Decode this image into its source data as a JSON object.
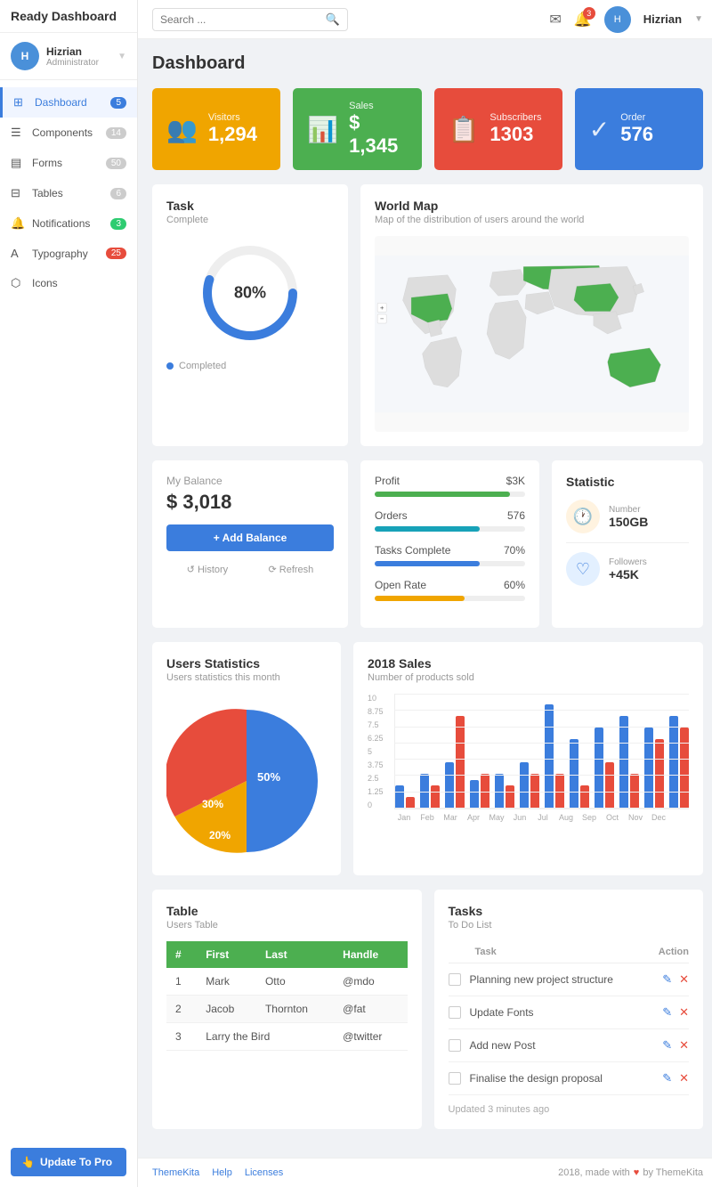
{
  "app": {
    "brand": "Ready Dashboard",
    "page_title": "Dashboard"
  },
  "sidebar": {
    "user": {
      "name": "Hizrian",
      "role": "Administrator",
      "initials": "H"
    },
    "items": [
      {
        "id": "dashboard",
        "label": "Dashboard",
        "icon": "⊞",
        "badge": "5",
        "badge_color": "blue",
        "active": true
      },
      {
        "id": "components",
        "label": "Components",
        "icon": "☰",
        "badge": "14",
        "badge_color": "none"
      },
      {
        "id": "forms",
        "label": "Forms",
        "icon": "▤",
        "badge": "50",
        "badge_color": "none"
      },
      {
        "id": "tables",
        "label": "Tables",
        "icon": "⊟",
        "badge": "6",
        "badge_color": "none"
      },
      {
        "id": "notifications",
        "label": "Notifications",
        "icon": "🔔",
        "badge": "3",
        "badge_color": "green"
      },
      {
        "id": "typography",
        "label": "Typography",
        "icon": "A",
        "badge": "25",
        "badge_color": "red"
      },
      {
        "id": "icons",
        "label": "Icons",
        "icon": "⬡",
        "badge": "",
        "badge_color": "none"
      }
    ],
    "update_btn": "Update To Pro"
  },
  "topbar": {
    "search_placeholder": "Search ...",
    "username": "Hizrian",
    "notification_count": "3"
  },
  "stat_cards": [
    {
      "label": "Visitors",
      "value": "1,294",
      "color": "orange",
      "icon": "👥"
    },
    {
      "label": "Sales",
      "value": "$ 1,345",
      "color": "green",
      "icon": "📊"
    },
    {
      "label": "Subscribers",
      "value": "1303",
      "color": "red",
      "icon": "📋"
    },
    {
      "label": "Order",
      "value": "576",
      "color": "blue",
      "icon": "✓"
    }
  ],
  "task_card": {
    "title": "Task",
    "subtitle": "Complete",
    "percentage": "80%",
    "completed_label": "Completed"
  },
  "world_map": {
    "title": "World Map",
    "subtitle": "Map of the distribution of users around the world"
  },
  "balance_card": {
    "label": "My Balance",
    "amount": "$ 3,018",
    "add_btn": "+ Add Balance",
    "history": "History",
    "refresh": "Refresh"
  },
  "progress_card": {
    "items": [
      {
        "label": "Profit",
        "value": "$3K",
        "percent": 90,
        "color": "green"
      },
      {
        "label": "Orders",
        "value": "576",
        "percent": 70,
        "color": "cyan"
      },
      {
        "label": "Tasks Complete",
        "value": "70%",
        "percent": 70,
        "color": "blue"
      },
      {
        "label": "Open Rate",
        "value": "60%",
        "percent": 60,
        "color": "orange"
      }
    ]
  },
  "statistic_card": {
    "title": "Statistic",
    "items": [
      {
        "label": "Number",
        "value": "150GB",
        "icon": "🕐",
        "icon_color": "orange"
      },
      {
        "label": "Followers",
        "value": "+45K",
        "icon": "♡",
        "icon_color": "blue"
      }
    ]
  },
  "users_stats": {
    "title": "Users Statistics",
    "subtitle": "Users statistics this month",
    "pie_data": [
      {
        "label": "50%",
        "color": "#3b7ddd",
        "percent": 50
      },
      {
        "label": "30%",
        "color": "#f0a500",
        "percent": 30
      },
      {
        "label": "20%",
        "color": "#e74c3c",
        "percent": 20
      }
    ]
  },
  "sales_chart": {
    "title": "2018 Sales",
    "subtitle": "Number of products sold",
    "y_labels": [
      "10",
      "8.75",
      "7.5",
      "6.25",
      "5",
      "3.75",
      "2.5",
      "1.25",
      "0"
    ],
    "months": [
      "Jan",
      "Feb",
      "Mar",
      "Apr",
      "May",
      "Jun",
      "Jul",
      "Aug",
      "Sep",
      "Oct",
      "Nov",
      "Dec"
    ],
    "blue_bars": [
      2,
      3,
      4,
      2.5,
      3,
      4,
      9,
      6,
      7,
      8,
      7,
      8
    ],
    "red_bars": [
      1,
      2,
      8,
      3,
      2,
      3,
      3,
      2,
      4,
      3,
      6,
      7
    ]
  },
  "table_card": {
    "title": "Table",
    "subtitle": "Users Table",
    "columns": [
      "#",
      "First",
      "Last",
      "Handle"
    ],
    "rows": [
      [
        "1",
        "Mark",
        "Otto",
        "@mdo"
      ],
      [
        "2",
        "Jacob",
        "Thornton",
        "@fat"
      ],
      [
        "3",
        "Larry the Bird",
        "",
        "@twitter"
      ]
    ]
  },
  "tasks_card": {
    "title": "Tasks",
    "subtitle": "To Do List",
    "col_task": "Task",
    "col_action": "Action",
    "items": [
      "Planning new project structure",
      "Update Fonts",
      "Add new Post",
      "Finalise the design proposal"
    ],
    "updated": "Updated 3 minutes ago"
  },
  "footer": {
    "links": [
      "ThemeKita",
      "Help",
      "Licenses"
    ],
    "copyright": "2018, made with",
    "brand": "ThemeKita"
  }
}
